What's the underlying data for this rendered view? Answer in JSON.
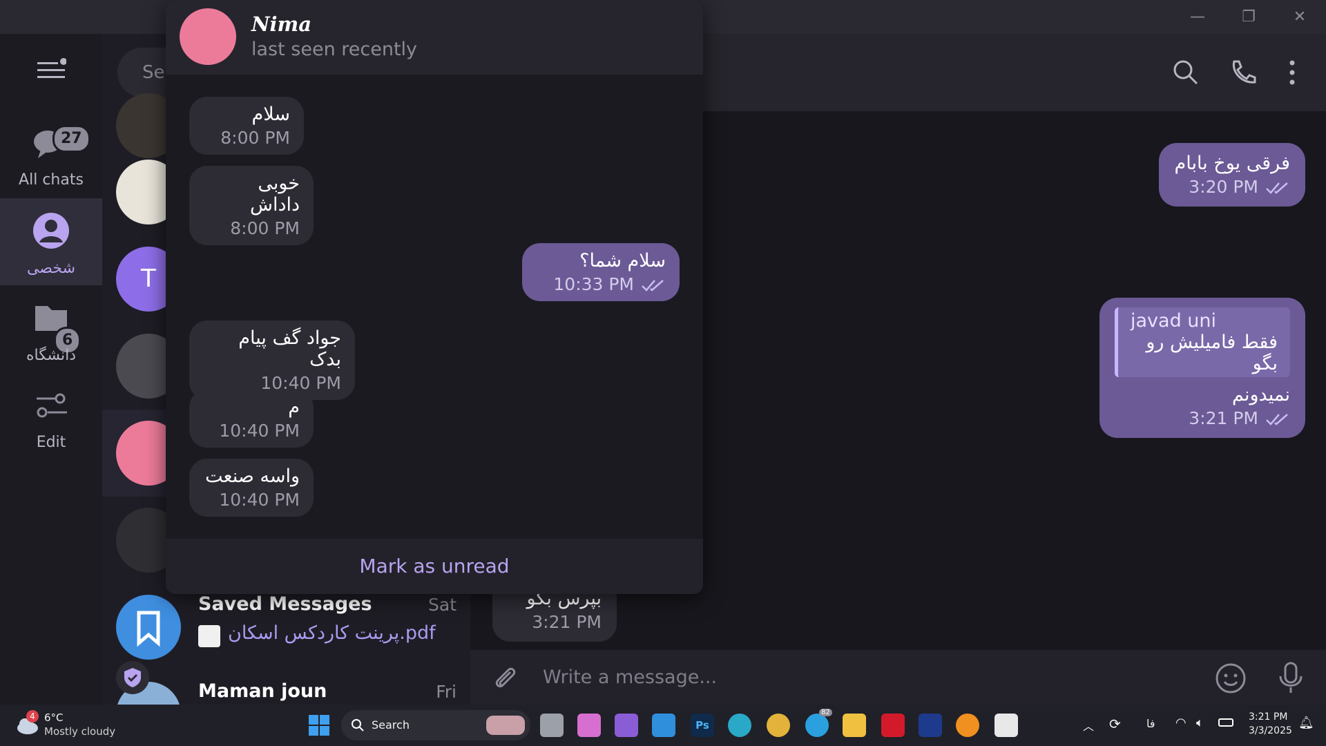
{
  "rail": {
    "all_chats": {
      "label": "All chats",
      "badge": "27"
    },
    "personal": {
      "label": "شخصی"
    },
    "university": {
      "label": "دانشگاه",
      "badge": "6"
    },
    "edit": {
      "label": "Edit"
    }
  },
  "chatlist": {
    "search_placeholder": "Sea",
    "saved": {
      "title": "Saved Messages",
      "time": "Sat",
      "sub": "پرینت کاردکس اسکان.pdf"
    },
    "maman": {
      "title": "Maman joun",
      "time": "Fri"
    },
    "avatar_letter": "T"
  },
  "chat": {
    "composer_placeholder": "Write a message...",
    "messages": [
      {
        "text": "فرقی یوخ بابام",
        "time": "3:20 PM"
      },
      {
        "reply_author": "javad uni",
        "reply_text": "فقط فامیلیش رو بگو",
        "text": "نمیدونم",
        "time": "3:21 PM"
      },
      {
        "text": "بپرس بگو",
        "time": "3:21 PM"
      }
    ]
  },
  "popup": {
    "name": "𝑵𝒊𝒎𝒂",
    "status": "last seen recently",
    "messages": [
      {
        "text": "سلام",
        "time": "8:00 PM"
      },
      {
        "text": "خوبی داداش",
        "time": "8:00 PM"
      },
      {
        "text": "سلام شما؟",
        "time": "10:33 PM"
      },
      {
        "text": "جواد گف پیام بدک",
        "time": "10:40 PM"
      },
      {
        "text": "م",
        "time": "10:40 PM"
      },
      {
        "text": "واسه صنعت",
        "time": "10:40 PM"
      }
    ],
    "mark_unread": "Mark as unread"
  },
  "taskbar": {
    "weather_temp": "6°C",
    "weather_desc": "Mostly cloudy",
    "weather_badge": "4",
    "search": "Search",
    "telegram_badge": "82",
    "lang": "فا",
    "time": "3:21 PM",
    "date": "3/3/2025"
  },
  "colors": {
    "accent": "#b9a4f0",
    "outgoing": "#6b5a96",
    "incoming": "#2d2c35",
    "nima_avatar": "#ec7b9a"
  }
}
